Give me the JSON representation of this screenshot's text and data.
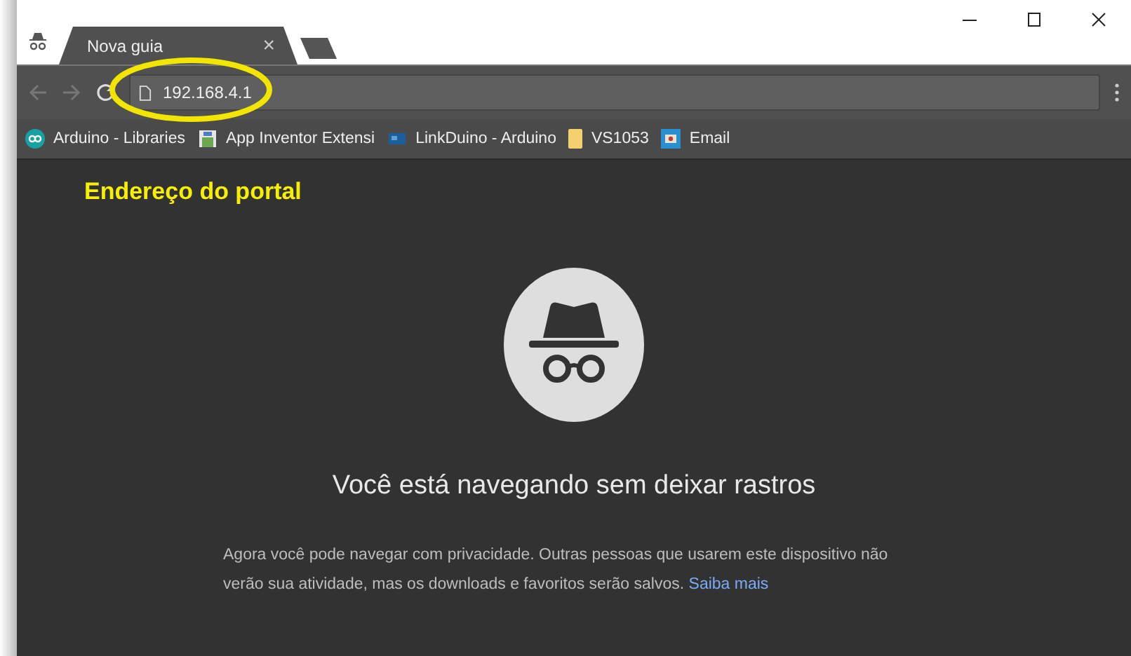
{
  "tabs": [
    {
      "label": "Nova guia",
      "selected": true,
      "close": "×"
    }
  ],
  "toolbar": {
    "address": "192.168.4.1"
  },
  "bookmarks": [
    {
      "label": "Arduino - Libraries",
      "kind": "arduino"
    },
    {
      "label": "App Inventor Extensi",
      "kind": "appinventor"
    },
    {
      "label": "LinkDuino - Arduino",
      "kind": "linkduino"
    },
    {
      "label": "VS1053",
      "kind": "folder"
    },
    {
      "label": "Email",
      "kind": "email"
    }
  ],
  "annotation": {
    "label": "Endereço do portal"
  },
  "incognito": {
    "heading": "Você está navegando sem deixar rastros",
    "text": "Agora você pode navegar com privacidade. Outras pessoas que usarem este dispositivo não verão sua atividade, mas os downloads e favoritos serão salvos.",
    "link": "Saiba mais"
  }
}
